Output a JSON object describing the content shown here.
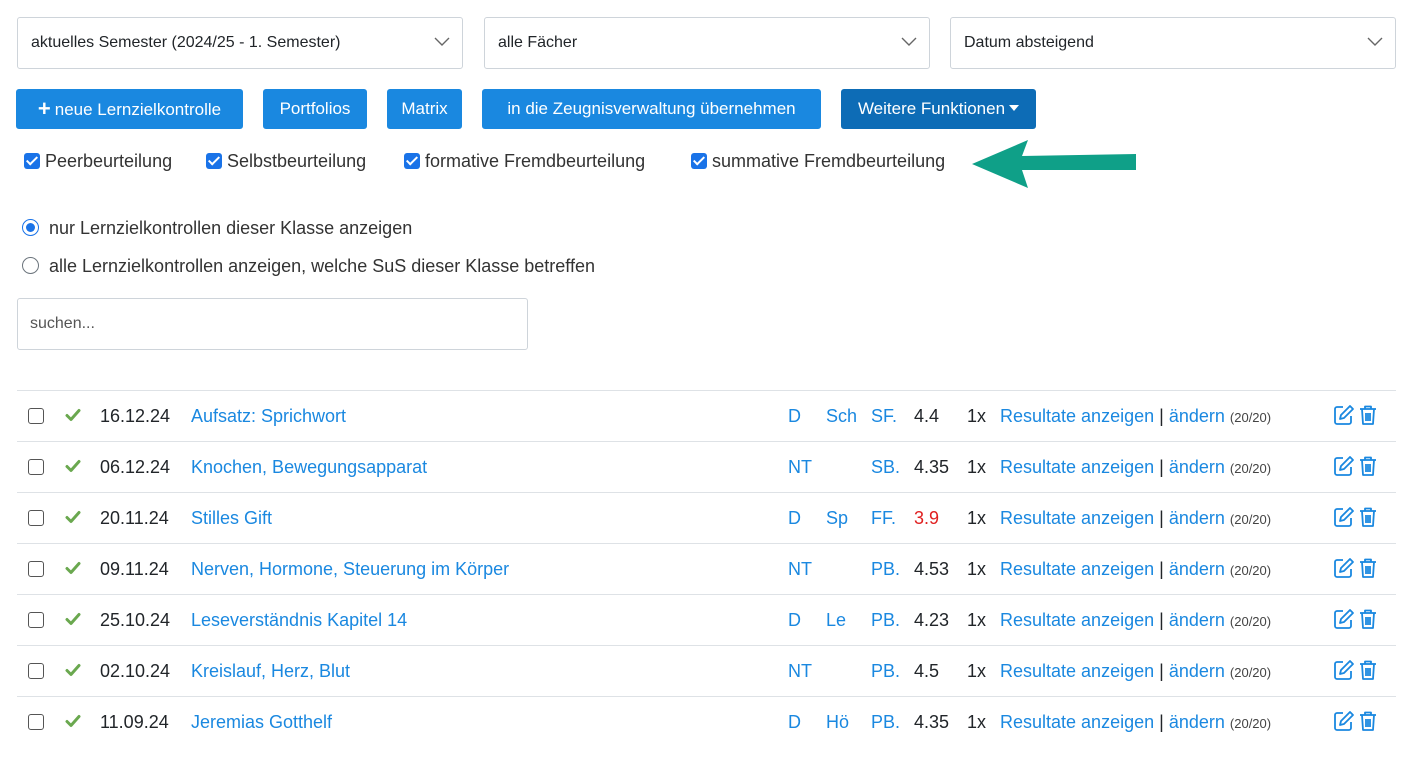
{
  "filters": {
    "semester": "aktuelles Semester (2024/25 - 1. Semester)",
    "subject": "alle Fächer",
    "sort": "Datum absteigend"
  },
  "buttons": {
    "new_check": "neue Lernzielkontrolle",
    "portfolios": "Portfolios",
    "matrix": "Matrix",
    "transfer": "in die Zeugnisverwaltung übernehmen",
    "more": "Weitere Funktionen"
  },
  "type_filters": [
    {
      "label": "Peerbeurteilung",
      "checked": true
    },
    {
      "label": "Selbstbeurteilung",
      "checked": true
    },
    {
      "label": "formative Fremdbeurteilung",
      "checked": true
    },
    {
      "label": "summative Fremdbeurteilung",
      "checked": true
    }
  ],
  "scope": {
    "option_class": "nur Lernzielkontrollen dieser Klasse anzeigen",
    "option_all": "alle Lernzielkontrollen anzeigen, welche SuS dieser Klasse betreffen",
    "selected": "option_class"
  },
  "search": {
    "placeholder": "suchen..."
  },
  "rows": [
    {
      "date": "16.12.24",
      "title": "Aufsatz: Sprichwort",
      "subject": "D",
      "sub": "Sch",
      "type": "SF.",
      "grade": "4.4",
      "count": "1x",
      "results": "Resultate anzeigen",
      "edit": "ändern",
      "progress": "(20/20)"
    },
    {
      "date": "06.12.24",
      "title": "Knochen, Bewegungsapparat",
      "subject": "NT",
      "sub": "",
      "type": "SB.",
      "grade": "4.35",
      "count": "1x",
      "results": "Resultate anzeigen",
      "edit": "ändern",
      "progress": "(20/20)"
    },
    {
      "date": "20.11.24",
      "title": "Stilles Gift",
      "subject": "D",
      "sub": "Sp",
      "type": "FF.",
      "grade": "3.9",
      "grade_low": true,
      "count": "1x",
      "results": "Resultate anzeigen",
      "edit": "ändern",
      "progress": "(20/20)"
    },
    {
      "date": "09.11.24",
      "title": "Nerven, Hormone, Steuerung im Körper",
      "subject": "NT",
      "sub": "",
      "type": "PB.",
      "grade": "4.53",
      "count": "1x",
      "results": "Resultate anzeigen",
      "edit": "ändern",
      "progress": "(20/20)"
    },
    {
      "date": "25.10.24",
      "title": "Leseverständnis Kapitel 14",
      "subject": "D",
      "sub": "Le",
      "type": "PB.",
      "grade": "4.23",
      "count": "1x",
      "results": "Resultate anzeigen",
      "edit": "ändern",
      "progress": "(20/20)"
    },
    {
      "date": "02.10.24",
      "title": "Kreislauf, Herz, Blut",
      "subject": "NT",
      "sub": "",
      "type": "PB.",
      "grade": "4.5",
      "count": "1x",
      "results": "Resultate anzeigen",
      "edit": "ändern",
      "progress": "(20/20)"
    },
    {
      "date": "11.09.24",
      "title": "Jeremias Gotthelf",
      "subject": "D",
      "sub": "Hö",
      "type": "PB.",
      "grade": "4.35",
      "count": "1x",
      "results": "Resultate anzeigen",
      "edit": "ändern",
      "progress": "(20/20)"
    }
  ],
  "colors": {
    "accent": "#1a88e0",
    "accent_dark": "#0d6cb6",
    "low_grade": "#e02020",
    "check": "#6aa84f",
    "arrow": "#0fa088"
  }
}
